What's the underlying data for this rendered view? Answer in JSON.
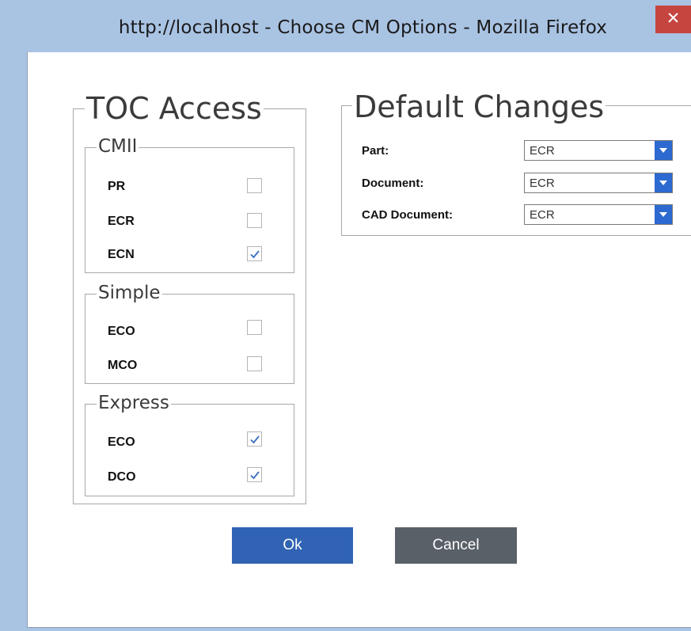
{
  "window": {
    "title": "http://localhost - Choose CM Options - Mozilla Firefox",
    "close_glyph": "✕"
  },
  "toc_access": {
    "legend": "TOC Access",
    "groups": {
      "cmii": {
        "legend": "CMII",
        "items": [
          {
            "label": "PR",
            "checked": false
          },
          {
            "label": "ECR",
            "checked": false
          },
          {
            "label": "ECN",
            "checked": true
          }
        ]
      },
      "simple": {
        "legend": "Simple",
        "items": [
          {
            "label": "ECO",
            "checked": false
          },
          {
            "label": "MCO",
            "checked": false
          }
        ]
      },
      "express": {
        "legend": "Express",
        "items": [
          {
            "label": "ECO",
            "checked": true
          },
          {
            "label": "DCO",
            "checked": true
          }
        ]
      }
    }
  },
  "default_changes": {
    "legend": "Default Changes",
    "rows": [
      {
        "label": "Part:",
        "value": "ECR"
      },
      {
        "label": "Document:",
        "value": "ECR"
      },
      {
        "label": "CAD Document:",
        "value": "ECR"
      }
    ]
  },
  "buttons": {
    "ok": "Ok",
    "cancel": "Cancel"
  },
  "colors": {
    "title_bar": "#a9c3e3",
    "close_button": "#c7453f",
    "primary_button": "#3063b3",
    "secondary_button": "#5a6068",
    "dropdown_arrow": "#2c6ad1",
    "check_mark": "#3a6fc0"
  },
  "icons": {
    "close": "close-icon",
    "check": "checkmark-icon",
    "dropdown": "chevron-down-icon"
  }
}
